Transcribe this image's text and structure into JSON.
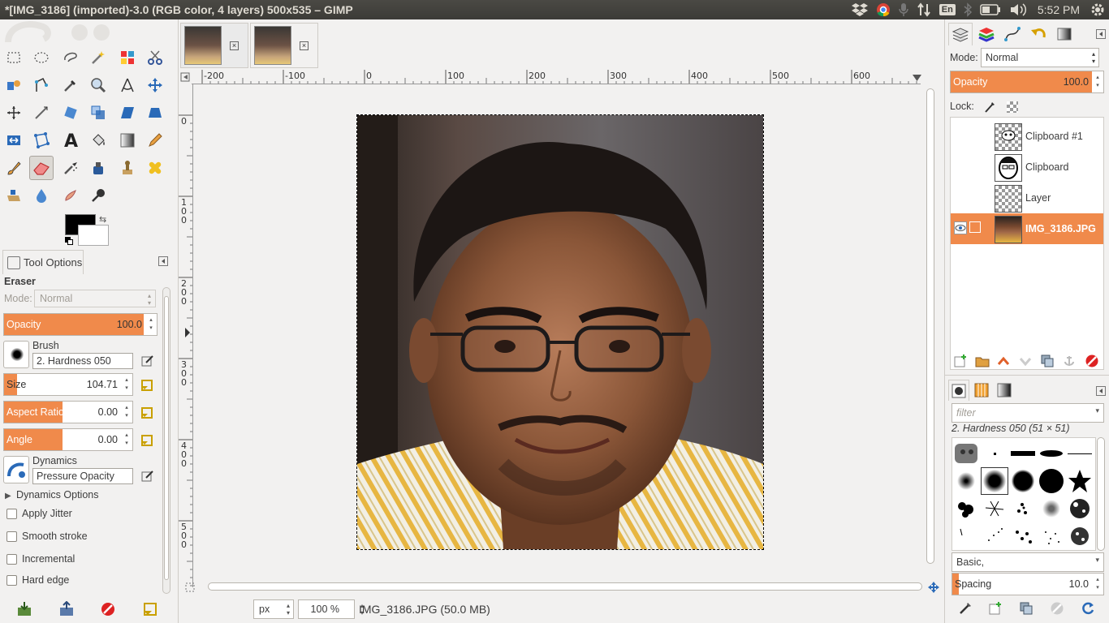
{
  "window": {
    "title": "*[IMG_3186] (imported)-3.0 (RGB color, 4 layers) 500x535 – GIMP"
  },
  "tray": {
    "keyboard": "En",
    "clock": "5:52 PM"
  },
  "tool_options": {
    "tab_label": "Tool Options",
    "tool_name": "Eraser",
    "mode_label": "Mode:",
    "mode_value": "Normal",
    "opacity": {
      "label": "Opacity",
      "value": "100.0",
      "fraction": 1.0
    },
    "brush_label": "Brush",
    "brush_value": "2. Hardness 050",
    "size": {
      "label": "Size",
      "value": "104.71",
      "fraction": 0.1
    },
    "aspect_ratio": {
      "label": "Aspect Ratio",
      "value": "0.00",
      "fraction": 0.5
    },
    "angle": {
      "label": "Angle",
      "value": "0.00",
      "fraction": 0.5
    },
    "dynamics_label": "Dynamics",
    "dynamics_value": "Pressure Opacity",
    "dynamics_options": "Dynamics Options",
    "checkboxes": [
      "Apply Jitter",
      "Smooth stroke",
      "Incremental",
      "Hard edge"
    ]
  },
  "canvas": {
    "ruler_labels": [
      "-200",
      "-100",
      "0",
      "100",
      "200",
      "300",
      "400",
      "500",
      "600"
    ],
    "vruler_labels": [
      "0",
      "1\n0\n0",
      "2\n0\n0",
      "3\n0\n0",
      "4\n0\n0",
      "5\n0\n0"
    ],
    "unit": "px",
    "zoom": "100 %",
    "status": "IMG_3186.JPG (50.0 MB)"
  },
  "layers_panel": {
    "mode_label": "Mode:",
    "mode_value": "Normal",
    "opacity_label": "Opacity",
    "opacity_value": "100.0",
    "lock_label": "Lock:",
    "layers": [
      {
        "name": "Clipboard #1",
        "selected": false
      },
      {
        "name": "Clipboard",
        "selected": false
      },
      {
        "name": "Layer",
        "selected": false
      },
      {
        "name": "IMG_3186.JPG",
        "selected": true
      }
    ]
  },
  "brushes_panel": {
    "filter_placeholder": "filter",
    "brush_info": "2. Hardness 050 (51 × 51)",
    "preset": "Basic,",
    "spacing_label": "Spacing",
    "spacing_value": "10.0"
  },
  "colors": {
    "accent": "#f08a4b",
    "fg": "#000000",
    "bg": "#ffffff"
  }
}
